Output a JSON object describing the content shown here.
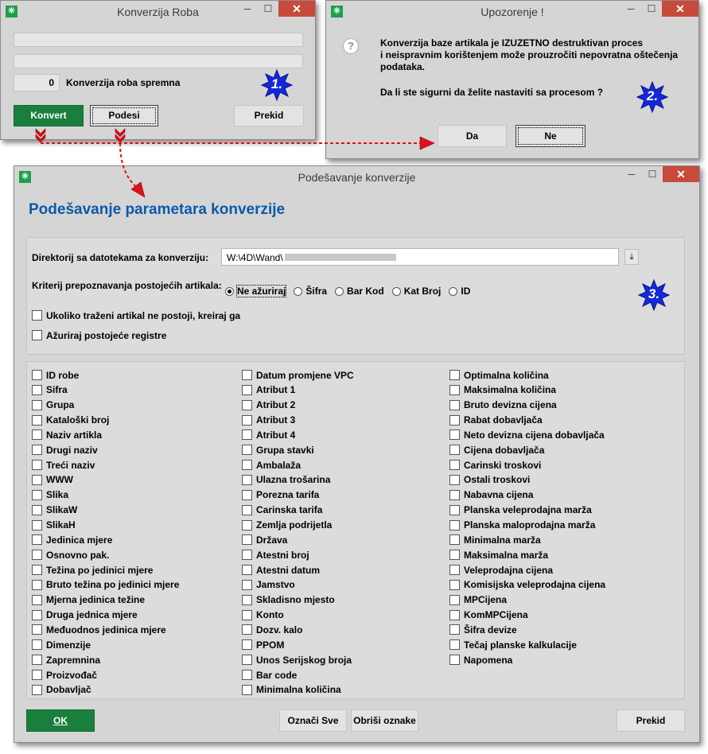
{
  "colors": {
    "accent_blue": "#0b5aa8",
    "green": "#1a7f3c",
    "close_red": "#c84a3c",
    "arrow_red": "#e0101a",
    "badge_blue": "#1428d8"
  },
  "win1": {
    "title": "Konverzija Roba",
    "counter": "0",
    "ready_label": "Konverzija roba spremna",
    "buttons": {
      "convert": "Konvert",
      "settings": "Podesi",
      "cancel": "Prekid"
    },
    "badge": "1."
  },
  "win2": {
    "title": "Upozorenje !",
    "message_line1": "Konverzija baze artikala je IZUZETNO destruktivan proces",
    "message_line2": "i neispravnim korištenjem može prouzročiti nepovratna oštečenja",
    "message_line3": "podataka.",
    "question": "Da li ste sigurni da želite nastaviti sa procesom ?",
    "buttons": {
      "yes": "Da",
      "no": "Ne"
    },
    "badge": "2.",
    "icon": "question-icon"
  },
  "win3": {
    "title": "Podešavanje konverzije",
    "heading": "Podešavanje parametara konverzije",
    "dir_label": "Direktorij sa datotekama za konverziju:",
    "dir_value": "W:\\4D\\Wand\\",
    "criteria_label": "Kriterij prepoznavanja postojećih artikala:",
    "criteria_options": [
      "Ne ažuriraj",
      "Šifra",
      "Bar Kod",
      "Kat Broj",
      "ID"
    ],
    "criteria_selected": "Ne ažuriraj",
    "create_missing": "Ukoliko traženi artikal ne postoji, kreiraj ga",
    "update_existing": "Ažuriraj postojeće registre",
    "badge": "3.",
    "fields_col1": [
      "ID robe",
      "Sifra",
      "Grupa",
      "Kataloški broj",
      "Naziv artikla",
      "Drugi naziv",
      "Treći naziv",
      "WWW",
      "Slika",
      "SlikaW",
      "SlikaH",
      "Jedinica mjere",
      "Osnovno pak.",
      "Težina po jedinici mjere",
      "Bruto težina po jedinici mjere",
      "Mjerna jedinica težine",
      "Druga jednica mjere",
      "Međuodnos jedinica mjere",
      "Dimenzije",
      "Zapremnina",
      "Proizvođač",
      "Dobavljač"
    ],
    "fields_col2": [
      "Datum promjene VPC",
      "Atribut 1",
      "Atribut 2",
      "Atribut 3",
      "Atribut 4",
      "Grupa stavki",
      "Ambalaža",
      "Ulazna trošarina",
      "Porezna tarifa",
      "Carinska tarifa",
      "Zemlja podrijetla",
      "Država",
      "Atestni broj",
      "Atestni datum",
      "Jamstvo",
      "Skladisno mjesto",
      "Konto",
      "Dozv. kalo",
      "PPOM",
      "Unos Serijskog broja",
      "Bar code",
      "Minimalna količina"
    ],
    "fields_col3": [
      "Optimalna količina",
      "Maksimalna količina",
      "Bruto devizna cijena",
      "Rabat dobavljača",
      "Neto devizna cijena dobavljača",
      "Cijena dobavljača",
      "Carinski troskovi",
      "Ostali troskovi",
      "Nabavna cijena",
      "Planska veleprodajna marža",
      "Planska maloprodajna marža",
      "Minimalna marža",
      "Maksimalna marža",
      "Veleprodajna cijena",
      "Komisijska veleprodajna cijena",
      "MPCijena",
      "KomMPCijena",
      "Šifra devize",
      "Tečaj planske kalkulacije",
      "Napomena"
    ],
    "buttons": {
      "ok": "OK",
      "select_all": "Označi Sve",
      "clear_all": "Obriši oznake",
      "cancel": "Prekid"
    }
  }
}
